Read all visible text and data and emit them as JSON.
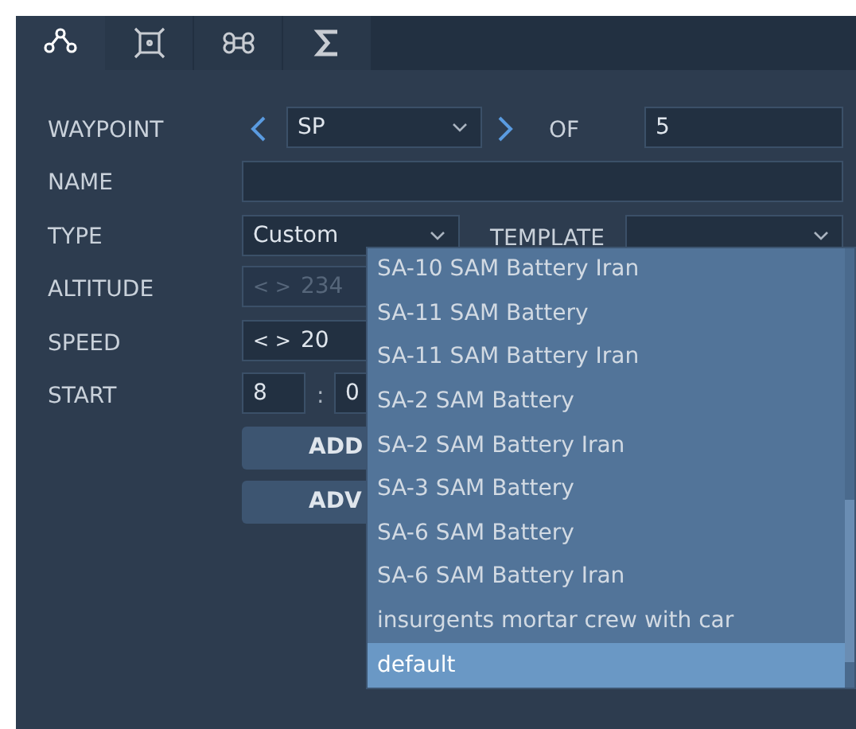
{
  "tabs": [
    {
      "kind": "path",
      "selected": true
    },
    {
      "kind": "target",
      "selected": false
    },
    {
      "kind": "command",
      "selected": false
    },
    {
      "kind": "sigma",
      "selected": false
    }
  ],
  "waypoint": {
    "label": "WAYPOINT",
    "value": "SP",
    "of_label": "OF",
    "count": "5"
  },
  "name": {
    "label": "NAME"
  },
  "type": {
    "label": "TYPE",
    "value": "Custom",
    "template_label": "TEMPLATE"
  },
  "altitude": {
    "label": "ALTITUDE",
    "arrows": "< >",
    "value": "234",
    "disabled": true
  },
  "speed": {
    "label": "SPEED",
    "arrows": "< >",
    "value": "20",
    "disabled": false
  },
  "start": {
    "label": "START",
    "hours": "8",
    "separator": ":",
    "minutes": "0"
  },
  "buttons": [
    "ADD",
    "ADV"
  ],
  "template_options": [
    {
      "label": "SA-10 SAM Battery Iran",
      "selected": false
    },
    {
      "label": "SA-11 SAM Battery",
      "selected": false
    },
    {
      "label": "SA-11 SAM Battery Iran",
      "selected": false
    },
    {
      "label": "SA-2 SAM Battery",
      "selected": false
    },
    {
      "label": "SA-2 SAM Battery Iran",
      "selected": false
    },
    {
      "label": "SA-3 SAM Battery",
      "selected": false
    },
    {
      "label": "SA-6 SAM Battery",
      "selected": false
    },
    {
      "label": "SA-6 SAM Battery Iran",
      "selected": false
    },
    {
      "label": "insurgents mortar crew with car",
      "selected": false
    },
    {
      "label": "default",
      "selected": true
    }
  ]
}
